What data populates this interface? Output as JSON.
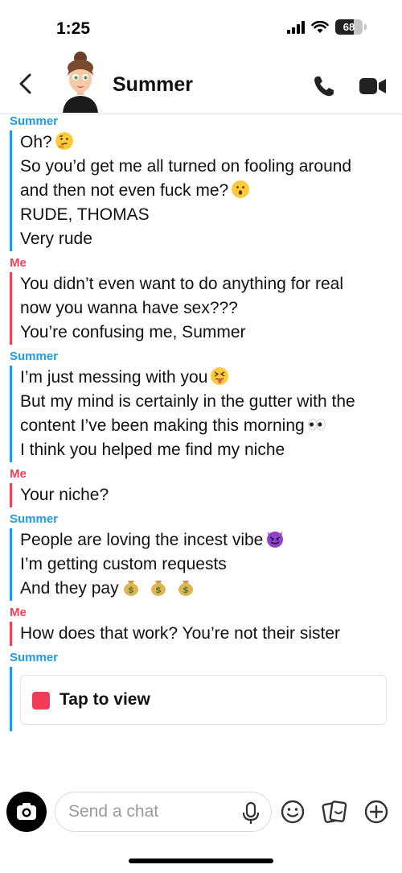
{
  "status_bar": {
    "time": "1:25",
    "battery": "68",
    "battery_level": 0.68
  },
  "header": {
    "contact_name": "Summer"
  },
  "messages": [
    {
      "sender": "Summer",
      "lines": [
        "Oh?",
        "So you’d get me all turned on fooling around",
        "and then not even fuck me?",
        "RUDE, THOMAS",
        "Very rude"
      ]
    },
    {
      "sender": "Me",
      "lines": [
        "You didn’t even want to do anything for real",
        "now you wanna have sex???",
        "You’re confusing me, Summer"
      ]
    },
    {
      "sender": "Summer",
      "lines": [
        "I’m just messing with you",
        "But my mind is certainly in the gutter with the",
        "content I’ve been making this morning",
        "I think you helped me find my niche"
      ]
    },
    {
      "sender": "Me",
      "lines": [
        "Your niche?"
      ]
    },
    {
      "sender": "Summer",
      "lines": [
        "People are loving the incest vibe",
        "I’m getting custom requests",
        "And they pay"
      ]
    },
    {
      "sender": "Me",
      "lines": [
        "How does that work? You’re not their sister"
      ]
    },
    {
      "sender": "Summer",
      "snap_label": "Tap to view"
    }
  ],
  "input_bar": {
    "placeholder": "Send a chat"
  },
  "icons": [
    "back-icon",
    "phone-icon",
    "video-icon",
    "camera-icon",
    "mic-icon",
    "smiley-icon",
    "sticker-icon",
    "plus-icon"
  ],
  "colors": {
    "summer": "#1e9be9",
    "me": "#f04358",
    "snap_square": "#f23c57"
  }
}
